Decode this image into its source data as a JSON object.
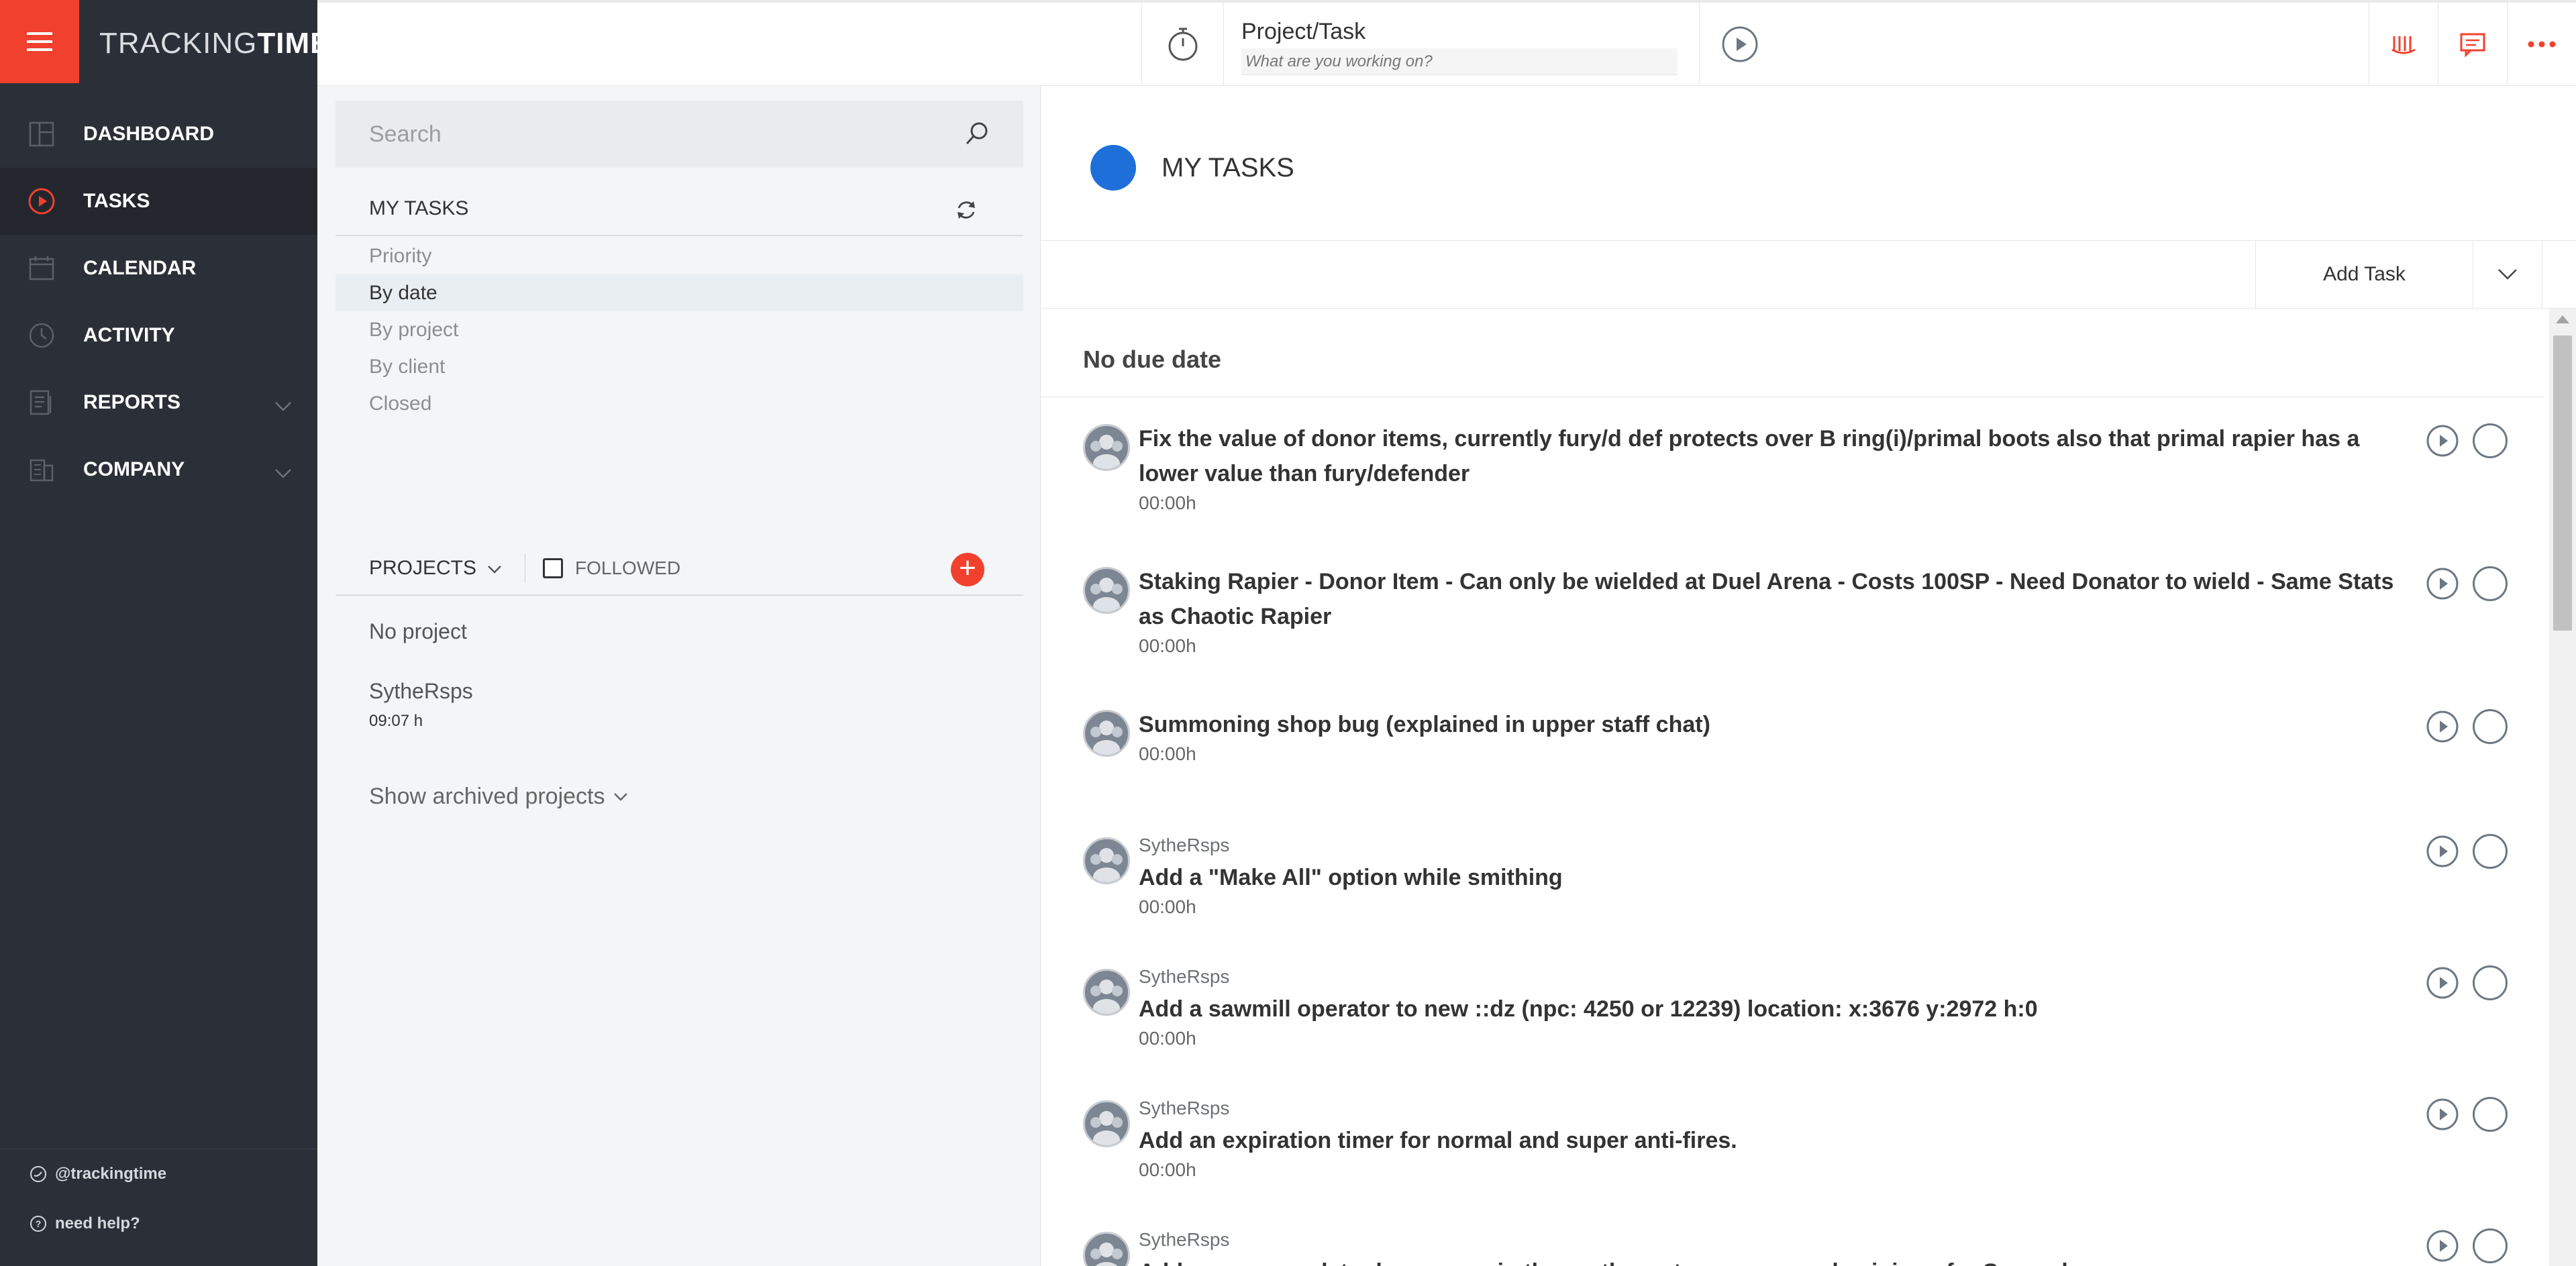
{
  "app": {
    "logo_light": "TRACKING",
    "logo_bold": "TIME"
  },
  "sidebar": {
    "items": [
      {
        "label": "DASHBOARD",
        "icon": "dashboard-icon"
      },
      {
        "label": "TASKS",
        "icon": "tasks-play-icon",
        "active": true
      },
      {
        "label": "CALENDAR",
        "icon": "calendar-icon"
      },
      {
        "label": "ACTIVITY",
        "icon": "clock-icon"
      },
      {
        "label": "REPORTS",
        "icon": "reports-icon",
        "has_chevron": true
      },
      {
        "label": "COMPANY",
        "icon": "company-icon",
        "has_chevron": true
      }
    ],
    "footer": {
      "twitter": "@trackingtime",
      "help": "need help?"
    }
  },
  "topbar": {
    "project_task_label": "Project/Task",
    "task_input_placeholder": "What are you working on?"
  },
  "middle": {
    "search_placeholder": "Search",
    "my_tasks_heading": "MY TASKS",
    "filters": [
      "Priority",
      "By date",
      "By project",
      "By client",
      "Closed"
    ],
    "active_filter": "By date",
    "projects_heading": "PROJECTS",
    "followed_label": "FOLLOWED",
    "add_project_symbol": "+",
    "projects": [
      {
        "name": "No project",
        "hours": ""
      },
      {
        "name": "SytheRsps",
        "hours": "09:07 h"
      }
    ],
    "show_archived": "Show archived projects"
  },
  "main": {
    "title": "MY TASKS",
    "title_dot_color": "#1e6fd9",
    "add_task_label": "Add Task",
    "group_heading": "No due date",
    "tasks": [
      {
        "project": "",
        "name": "Fix the value of donor items, currently fury/d def protects over B ring(i)/primal boots also that primal rapier has a lower value than fury/defender",
        "duration": "00:00h"
      },
      {
        "project": "",
        "name": "Staking Rapier - Donor Item - Can only be wielded at Duel Arena - Costs 100SP - Need Donator to wield - Same Stats as Chaotic Rapier",
        "duration": "00:00h"
      },
      {
        "project": "",
        "name": "Summoning shop bug (explained in upper staff chat)",
        "duration": "00:00h"
      },
      {
        "project": "SytheRsps",
        "name": "Add a \"Make All\" option while smithing",
        "duration": "00:00h"
      },
      {
        "project": "SytheRsps",
        "name": "Add a sawmill operator to new ::dz (npc: 4250 or 12239) location: x:3676 y:2972 h:0",
        "duration": "00:00h"
      },
      {
        "project": "SytheRsps",
        "name": "Add an expiration timer for normal and super anti-fires.",
        "duration": "00:00h"
      },
      {
        "project": "SytheRsps",
        "name": "Add essence rock to donor zone in the north-west near gem-rock mining - for Super donor+",
        "duration": ""
      }
    ]
  },
  "colors": {
    "accent": "#f1412e",
    "sidebar_bg": "#2b3038",
    "primary_blue": "#1e6fd9"
  }
}
